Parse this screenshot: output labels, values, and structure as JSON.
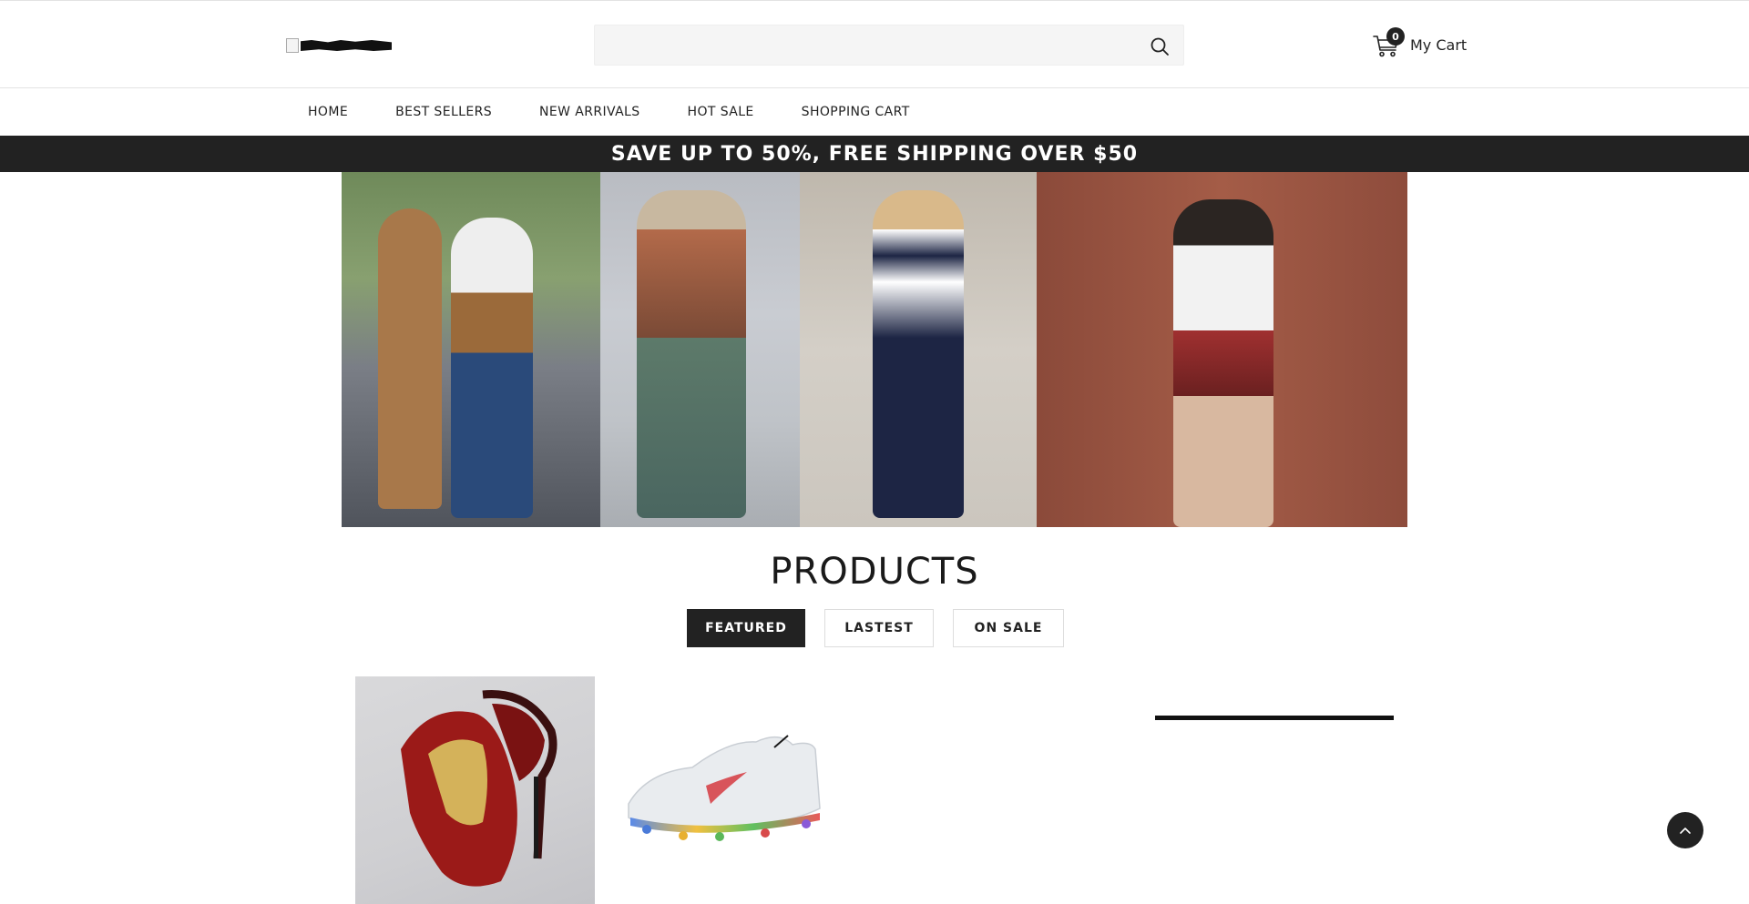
{
  "header": {
    "logo_alt": "",
    "search": {
      "value": "",
      "placeholder": ""
    },
    "cart": {
      "count": "0",
      "label": "My Cart"
    }
  },
  "nav": {
    "items": [
      {
        "label": "HOME"
      },
      {
        "label": "BEST SELLERS"
      },
      {
        "label": "NEW ARRIVALS"
      },
      {
        "label": "HOT SALE"
      },
      {
        "label": "SHOPPING CART"
      }
    ]
  },
  "promo": {
    "text": "SAVE UP TO 50%, FREE SHIPPING OVER $50"
  },
  "products": {
    "title": "PRODUCTS",
    "tabs": [
      {
        "label": "FEATURED",
        "active": true
      },
      {
        "label": "LASTEST",
        "active": false
      },
      {
        "label": "ON SALE",
        "active": false
      }
    ]
  },
  "icons": {
    "search": "search-icon",
    "cart": "cart-icon",
    "back_to_top": "chevron-up-icon"
  },
  "colors": {
    "accent": "#222222",
    "promo_bg": "#222222",
    "search_bg": "#f5f5f5"
  }
}
